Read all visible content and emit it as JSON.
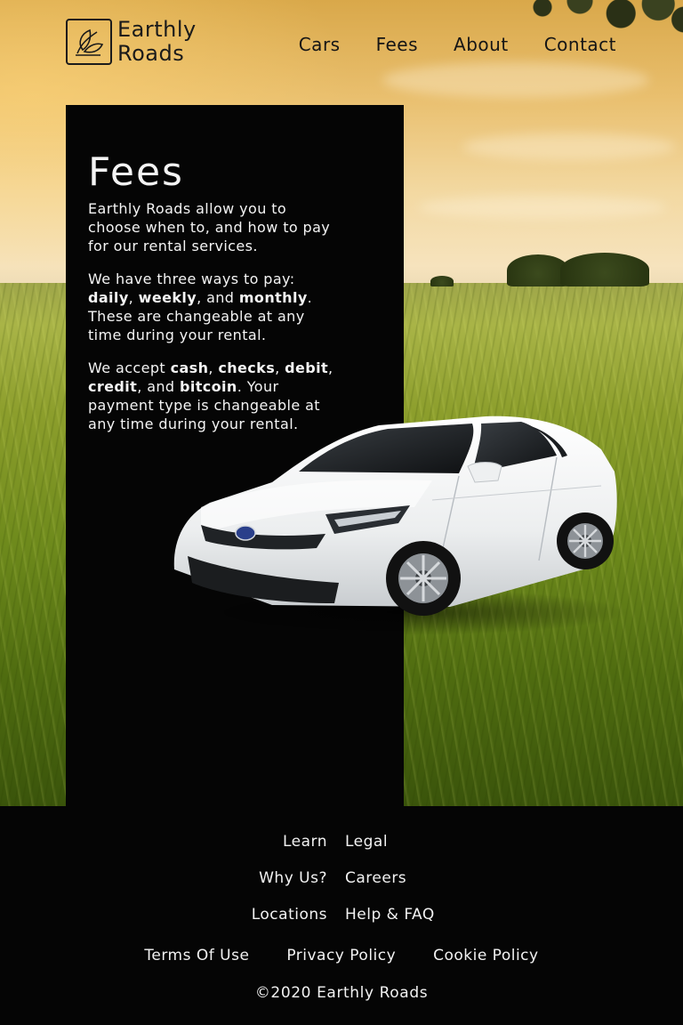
{
  "brand": {
    "line1": "Earthly",
    "line2": "Roads",
    "logo_icon": "leaf-icon"
  },
  "nav": [
    "Cars",
    "Fees",
    "About",
    "Contact"
  ],
  "fees": {
    "title": "Fees",
    "intro": "Earthly Roads allow you to choose when to, and how to pay for our rental services.",
    "p2_lead": "We have three ways to pay: ",
    "p2_opt1": "daily",
    "p2_opt2": "weekly",
    "p2_opt3": "monthly",
    "p2_tail": ". These are changeable at any time during your rental.",
    "p3_lead": "We accept ",
    "p3_m1": "cash",
    "p3_m2": "checks",
    "p3_m3": "debit",
    "p3_m4": "credit",
    "p3_m5": "bitcoin",
    "p3_tail": ". Your payment type is changeable at any time during your rental.",
    "sep_comma": ", ",
    "sep_and": ", and "
  },
  "footer": {
    "links_left": [
      "Learn",
      "Why Us?",
      "Locations"
    ],
    "links_right": [
      "Legal",
      "Careers",
      "Help & FAQ"
    ],
    "policies": [
      "Terms Of Use",
      "Privacy Policy",
      "Cookie Policy"
    ],
    "copyright": "©2020 Earthly Roads"
  }
}
